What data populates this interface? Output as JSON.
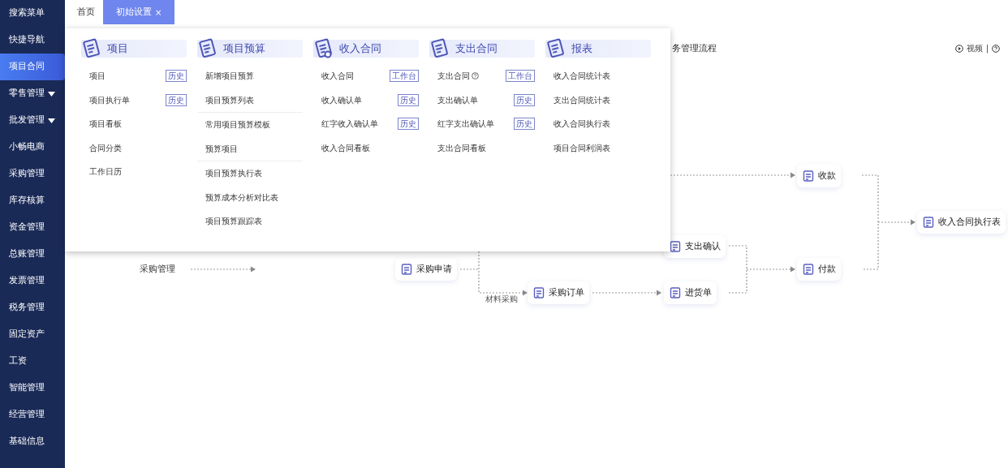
{
  "sidebar": {
    "items": [
      {
        "label": "搜索菜单",
        "selected": false,
        "expandable": false
      },
      {
        "label": "快捷导航",
        "selected": false,
        "expandable": false
      },
      {
        "label": "项目合同",
        "selected": true,
        "expandable": false
      },
      {
        "label": "零售管理",
        "selected": false,
        "expandable": true
      },
      {
        "label": "批发管理",
        "selected": false,
        "expandable": true
      },
      {
        "label": "小畅电商",
        "selected": false,
        "expandable": false
      },
      {
        "label": "采购管理",
        "selected": false,
        "expandable": false
      },
      {
        "label": "库存核算",
        "selected": false,
        "expandable": false
      },
      {
        "label": "资金管理",
        "selected": false,
        "expandable": false
      },
      {
        "label": "总账管理",
        "selected": false,
        "expandable": false
      },
      {
        "label": "发票管理",
        "selected": false,
        "expandable": false
      },
      {
        "label": "税务管理",
        "selected": false,
        "expandable": false
      },
      {
        "label": "固定资产",
        "selected": false,
        "expandable": false
      },
      {
        "label": "工资",
        "selected": false,
        "expandable": false
      },
      {
        "label": "智能管理",
        "selected": false,
        "expandable": false
      },
      {
        "label": "经营管理",
        "selected": false,
        "expandable": false
      },
      {
        "label": "基础信息",
        "selected": false,
        "expandable": false
      }
    ]
  },
  "tabs": [
    {
      "label": "首页",
      "selected": false
    },
    {
      "label": "初始设置",
      "selected": true,
      "close": "×"
    }
  ],
  "flow": {
    "title": "务管理流程",
    "video": "视频",
    "separator": "|",
    "labels": [
      {
        "text": "采购管理",
        "kind": "section"
      },
      {
        "text": "材料采购",
        "kind": "edge"
      }
    ],
    "nodes": [
      {
        "label": "收款"
      },
      {
        "label": "收入合同执行表"
      },
      {
        "label": "支出确认"
      },
      {
        "label": "付款"
      },
      {
        "label": "采购申请"
      },
      {
        "label": "采购订单"
      },
      {
        "label": "进货单"
      }
    ]
  },
  "menu_panel": {
    "columns": [
      {
        "title": "项目",
        "sections": [
          [
            {
              "label": "项目",
              "badge": "历史"
            },
            {
              "label": "项目执行单",
              "badge": "历史"
            },
            {
              "label": "项目看板"
            },
            {
              "label": "合同分类"
            },
            {
              "label": "工作日历"
            }
          ]
        ]
      },
      {
        "title": "项目预算",
        "sections": [
          [
            {
              "label": "新增项目预算"
            },
            {
              "label": "项目预算列表"
            }
          ],
          [
            {
              "label": "常用项目预算模板"
            },
            {
              "label": "预算项目"
            }
          ],
          [
            {
              "label": "项目预算执行表"
            },
            {
              "label": "预算成本分析对比表"
            },
            {
              "label": "项目预算跟踪表"
            }
          ]
        ]
      },
      {
        "title": "收入合同",
        "sections": [
          [
            {
              "label": "收入合同",
              "badge": "工作台"
            },
            {
              "label": "收入确认单",
              "badge": "历史"
            },
            {
              "label": "红字收入确认单",
              "badge": "历史"
            },
            {
              "label": "收入合同看板"
            }
          ]
        ]
      },
      {
        "title": "支出合同",
        "sections": [
          [
            {
              "label": "支出合同",
              "badge": "工作台",
              "help": true
            },
            {
              "label": "支出确认单",
              "badge": "历史"
            },
            {
              "label": "红字支出确认单",
              "badge": "历史"
            },
            {
              "label": "支出合同看板"
            }
          ]
        ]
      },
      {
        "title": "报表",
        "sections": [
          [
            {
              "label": "收入合同统计表"
            },
            {
              "label": "支出合同统计表"
            },
            {
              "label": "收入合同执行表"
            },
            {
              "label": "项目合同利润表"
            }
          ]
        ]
      }
    ]
  }
}
